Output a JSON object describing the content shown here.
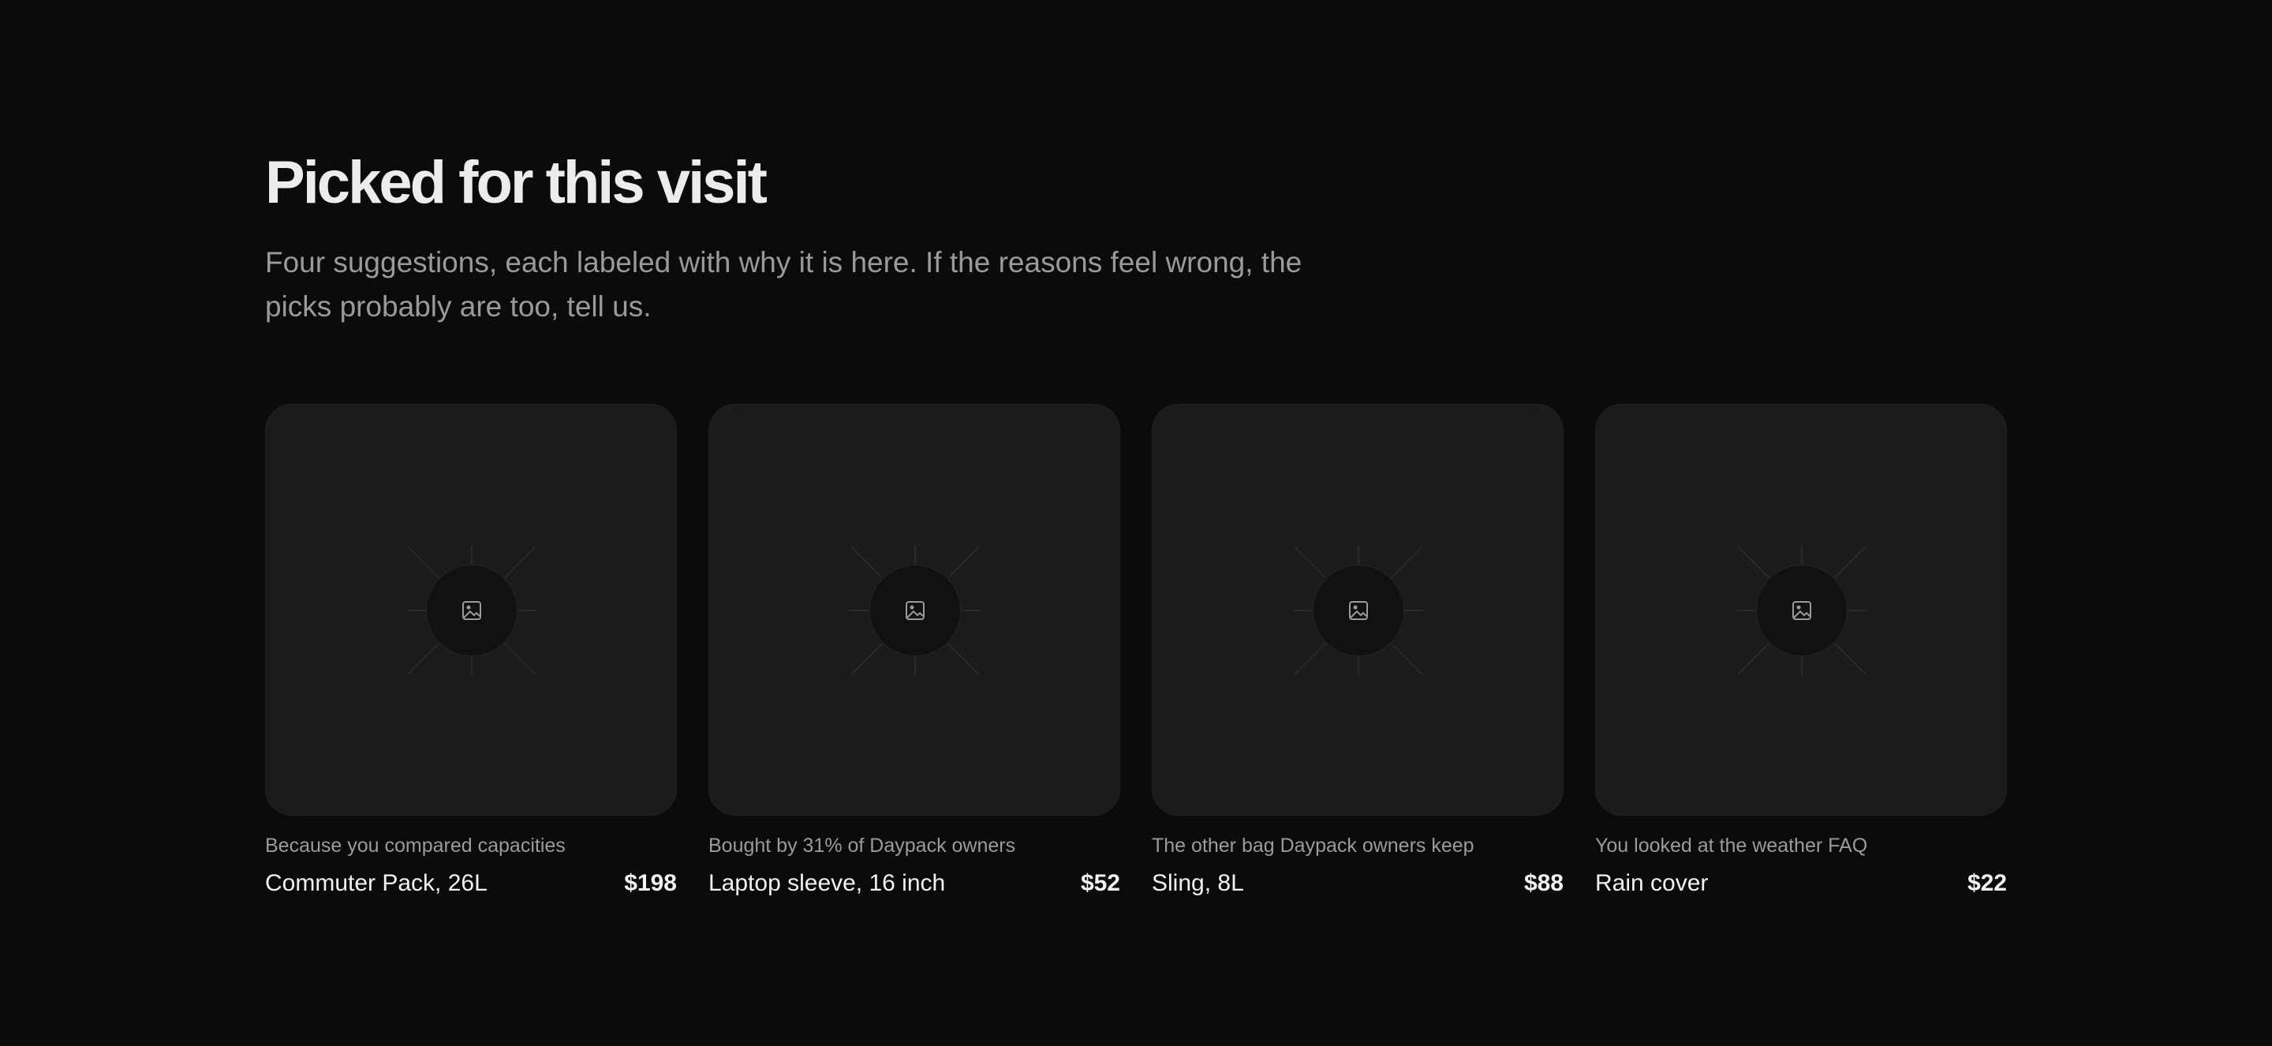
{
  "section": {
    "title": "Picked for this visit",
    "subtitle": "Four suggestions, each labeled with why it is here. If the reasons feel wrong, the picks probably are too, tell us."
  },
  "products": [
    {
      "reason": "Because you compared capacities",
      "name": "Commuter Pack, 26L",
      "price": "$198",
      "icon": "image-placeholder-icon"
    },
    {
      "reason": "Bought by 31% of Daypack owners",
      "name": "Laptop sleeve, 16 inch",
      "price": "$52",
      "icon": "image-placeholder-icon"
    },
    {
      "reason": "The other bag Daypack owners keep",
      "name": "Sling, 8L",
      "price": "$88",
      "icon": "image-placeholder-icon"
    },
    {
      "reason": "You looked at the weather FAQ",
      "name": "Rain cover",
      "price": "$22",
      "icon": "image-placeholder-icon"
    }
  ]
}
